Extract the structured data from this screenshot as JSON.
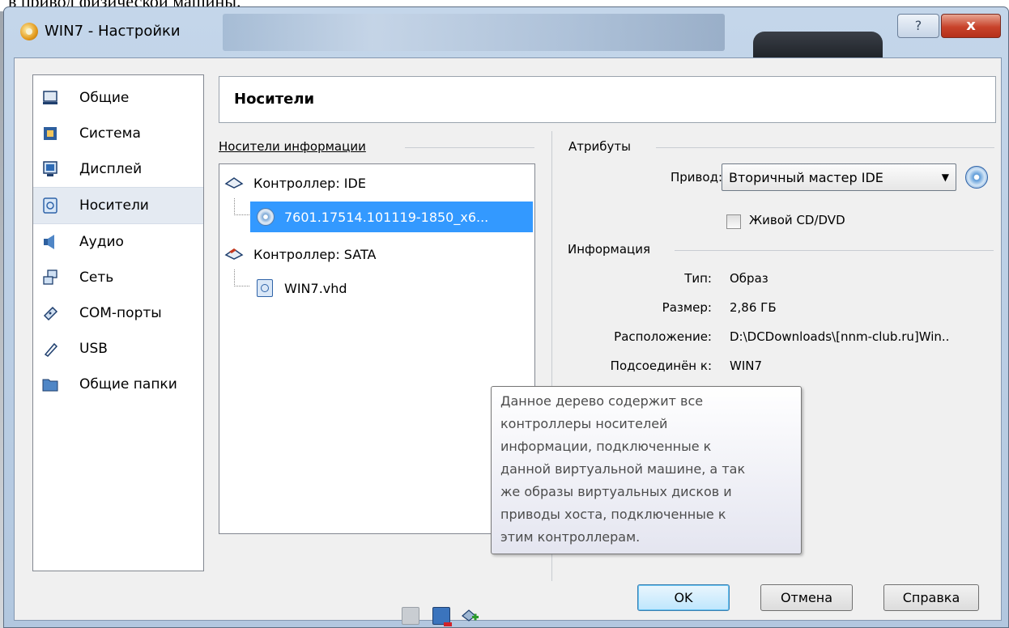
{
  "doc_text_above": "в привод физической машины.",
  "window": {
    "title": "WIN7 - Настройки",
    "help_glyph": "?",
    "close_glyph": "x"
  },
  "sidebar": {
    "items": [
      {
        "label": "Общие",
        "icon": "monitor-icon",
        "selected": false
      },
      {
        "label": "Система",
        "icon": "chip-icon",
        "selected": false
      },
      {
        "label": "Дисплей",
        "icon": "display-icon",
        "selected": false
      },
      {
        "label": "Носители",
        "icon": "storage-icon",
        "selected": true
      },
      {
        "label": "Аудио",
        "icon": "speaker-icon",
        "selected": false
      },
      {
        "label": "Сеть",
        "icon": "network-icon",
        "selected": false
      },
      {
        "label": "COM-порты",
        "icon": "serial-port-icon",
        "selected": false
      },
      {
        "label": "USB",
        "icon": "usb-icon",
        "selected": false
      },
      {
        "label": "Общие папки",
        "icon": "folder-icon",
        "selected": false
      }
    ]
  },
  "page": {
    "title": "Носители"
  },
  "storage": {
    "group_title": "Носители информации",
    "tree": [
      {
        "label": "Контроллер: IDE",
        "type": "controller",
        "icon": "ide-controller-icon"
      },
      {
        "label": "7601.17514.101119-1850_x6...",
        "type": "optical",
        "icon": "cd-disc-icon",
        "selected": true
      },
      {
        "label": "Контроллер: SATA",
        "type": "controller",
        "icon": "sata-controller-icon"
      },
      {
        "label": "WIN7.vhd",
        "type": "hdd",
        "icon": "hdd-icon"
      }
    ],
    "toolbar": [
      "remove-controller-icon",
      "add-hdd-icon",
      "add-attachment-icon"
    ]
  },
  "attributes": {
    "group_title": "Атрибуты",
    "drive_label": "Привод:",
    "drive_value": "Вторичный мастер IDE",
    "live_cd_label": "Живой CD/DVD",
    "live_cd_checked": false
  },
  "information": {
    "group_title": "Информация",
    "rows": [
      {
        "label": "Тип:",
        "value": "Образ"
      },
      {
        "label": "Размер:",
        "value": "2,86 ГБ"
      },
      {
        "label": "Расположение:",
        "value": "D:\\DCDownloads\\[nnm-club.ru]Win.."
      },
      {
        "label": "Подсоединён к:",
        "value": "WIN7"
      }
    ]
  },
  "tooltip": {
    "lines": [
      "Данное дерево содержит все",
      "контроллеры носителей",
      "информации, подключенные к",
      "данной виртуальной машине, а так",
      "же образы виртуальных дисков и",
      "приводы хоста, подключенные к",
      "этим контроллерам."
    ]
  },
  "buttons": {
    "ok": "OK",
    "cancel": "Отмена",
    "help": "Справка"
  }
}
